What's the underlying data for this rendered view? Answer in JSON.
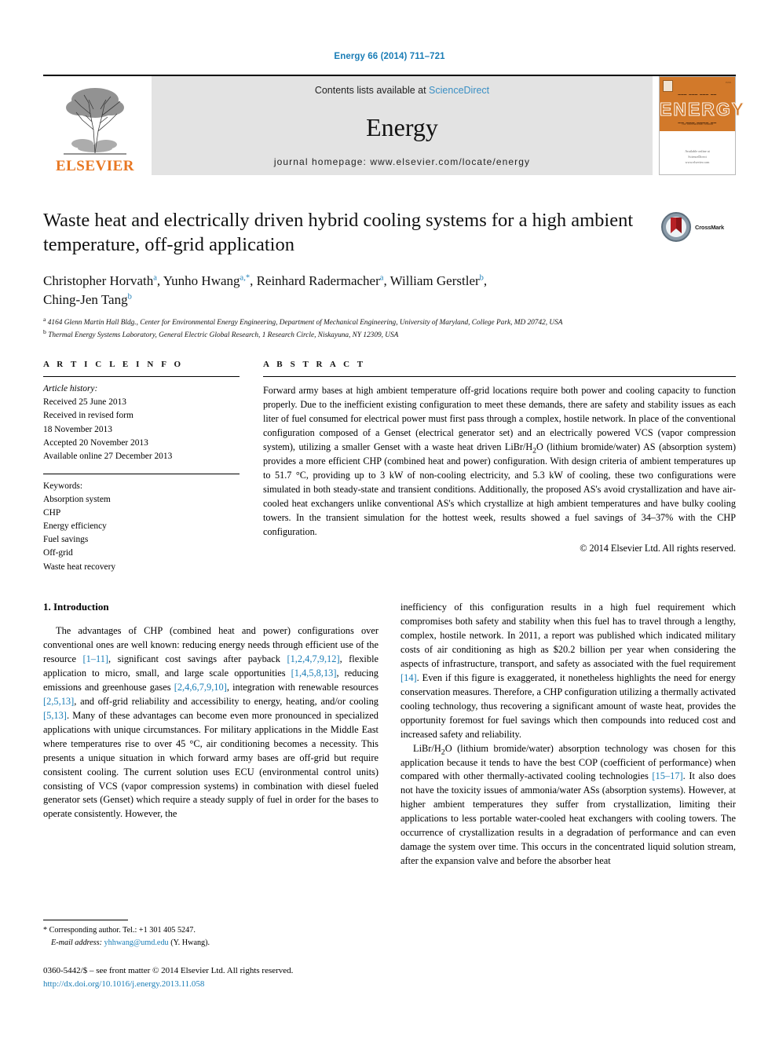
{
  "running_head": "Energy 66 (2014) 711–721",
  "masthead": {
    "publisher": "ELSEVIER",
    "contents_prefix": "Contents lists available at ",
    "contents_link": "ScienceDirect",
    "journal_name": "Energy",
    "homepage": "journal homepage: www.elsevier.com/locate/energy",
    "cover_title": "ENERGY",
    "cover_tagline": "The International Journal",
    "cover_publisher": "Available online at\nScienceDirect\nwww.elsevier.com/locate/energy"
  },
  "article": {
    "title": "Waste heat and electrically driven hybrid cooling systems for a high ambient temperature, off-grid application",
    "crossmark_label": "CrossMark",
    "authors_line1": "Christopher Horvath a, Yunho Hwang a,*, Reinhard Radermacher a, William Gerstler b,",
    "authors_line2": "Ching-Jen Tang b",
    "authors": [
      {
        "name": "Christopher Horvath",
        "marks": "a"
      },
      {
        "name": "Yunho Hwang",
        "marks": "a,*"
      },
      {
        "name": "Reinhard Radermacher",
        "marks": "a"
      },
      {
        "name": "William Gerstler",
        "marks": "b"
      },
      {
        "name": "Ching-Jen Tang",
        "marks": "b"
      }
    ],
    "affiliations": [
      {
        "mark": "a",
        "text": "4164 Glenn Martin Hall Bldg., Center for Environmental Energy Engineering, Department of Mechanical Engineering, University of Maryland, College Park, MD 20742, USA"
      },
      {
        "mark": "b",
        "text": "Thermal Energy Systems Laboratory, General Electric Global Research, 1 Research Circle, Niskayuna, NY 12309, USA"
      }
    ]
  },
  "article_info": {
    "heading": "A R T I C L E   I N F O",
    "history_label": "Article history:",
    "history": [
      "Received 25 June 2013",
      "Received in revised form",
      "18 November 2013",
      "Accepted 20 November 2013",
      "Available online 27 December 2013"
    ],
    "keywords_label": "Keywords:",
    "keywords": [
      "Absorption system",
      "CHP",
      "Energy efficiency",
      "Fuel savings",
      "Off-grid",
      "Waste heat recovery"
    ]
  },
  "abstract": {
    "heading": "A B S T R A C T",
    "paragraph_part1": "Forward army bases at high ambient temperature off-grid locations require both power and cooling capacity to function properly. Due to the inefficient existing configuration to meet these demands, there are safety and stability issues as each liter of fuel consumed for electrical power must first pass through a complex, hostile network. In place of the conventional configuration composed of a Genset (electrical generator set) and an electrically powered VCS (vapor compression system), utilizing a smaller Genset with a waste heat driven LiBr/H",
    "paragraph_sub1": "2",
    "paragraph_part2": "O (lithium bromide/water) AS (absorption system) provides a more efficient CHP (combined heat and power) configuration. With design criteria of ambient temperatures up to 51.7 °C, providing up to 3 kW of non-cooling electricity, and 5.3 kW of cooling, these two configurations were simulated in both steady-state and transient conditions. Additionally, the proposed AS's avoid crystallization and have air-cooled heat exchangers unlike conventional AS's which crystallize at high ambient temperatures and have bulky cooling towers. In the transient simulation for the hottest week, results showed a fuel savings of 34–37% with the CHP configuration.",
    "copyright": "© 2014 Elsevier Ltd. All rights reserved."
  },
  "introduction": {
    "heading": "1. Introduction",
    "left_p1_a": "The advantages of CHP (combined heat and power) configurations over conventional ones are well known: reducing energy needs through efficient use of the resource ",
    "left_p1_ref1": "[1–11]",
    "left_p1_b": ", significant cost savings after payback ",
    "left_p1_ref2": "[1,2,4,7,9,12]",
    "left_p1_c": ", flexible application to micro, small, and large scale opportunities ",
    "left_p1_ref3": "[1,4,5,8,13]",
    "left_p1_d": ", reducing emissions and greenhouse gases ",
    "left_p1_ref4": "[2,4,6,7,9,10]",
    "left_p1_e": ", integration with renewable resources ",
    "left_p1_ref5": "[2,5,13]",
    "left_p1_f": ", and off-grid reliability and accessibility to energy, heating, and/or cooling ",
    "left_p1_ref6": "[5,13]",
    "left_p1_g": ". Many of these advantages can become even more pronounced in specialized applications with unique circumstances. For military applications in the Middle East where temperatures rise to over 45 °C, air conditioning becomes a necessity. This presents a unique situation in which forward army bases are off-grid but require consistent cooling. The current solution uses ECU (environmental control units) consisting of VCS (vapor compression systems) in combination with diesel fueled generator sets (Genset) which require a steady supply of fuel in order for the bases to operate consistently. However, the",
    "right_p1_a": "inefficiency of this configuration results in a high fuel requirement which compromises both safety and stability when this fuel has to travel through a lengthy, complex, hostile network. In 2011, a report was published which indicated military costs of air conditioning as high as $20.2 billion per year when considering the aspects of infrastructure, transport, and safety as associated with the fuel requirement ",
    "right_p1_ref1": "[14]",
    "right_p1_b": ". Even if this figure is exaggerated, it nonetheless highlights the need for energy conservation measures. Therefore, a CHP configuration utilizing a thermally activated cooling technology, thus recovering a significant amount of waste heat, provides the opportunity foremost for fuel savings which then compounds into reduced cost and increased safety and reliability.",
    "right_p2_a": "LiBr/H",
    "right_p2_sub": "2",
    "right_p2_b": "O (lithium bromide/water) absorption technology was chosen for this application because it tends to have the best COP (coefficient of performance) when compared with other thermally-activated cooling technologies ",
    "right_p2_ref1": "[15–17]",
    "right_p2_c": ". It also does not have the toxicity issues of ammonia/water ASs (absorption systems). However, at higher ambient temperatures they suffer from crystallization, limiting their applications to less portable water-cooled heat exchangers with cooling towers. The occurrence of crystallization results in a degradation of performance and can even damage the system over time. This occurs in the concentrated liquid solution stream, after the expansion valve and before the absorber heat"
  },
  "footer": {
    "corresponding_mark": "*",
    "corresponding_text": " Corresponding author. Tel.: +1 301 405 5247.",
    "email_label": "E-mail address:",
    "email": "yhhwang@umd.edu",
    "email_suffix": "(Y. Hwang).",
    "issn_line": "0360-5442/$ – see front matter © 2014 Elsevier Ltd. All rights reserved.",
    "doi": "http://dx.doi.org/10.1016/j.energy.2013.11.058"
  },
  "colors": {
    "link": "#1a7db6",
    "elsevier_orange": "#e87722",
    "band_gray": "#e3e3e3"
  }
}
